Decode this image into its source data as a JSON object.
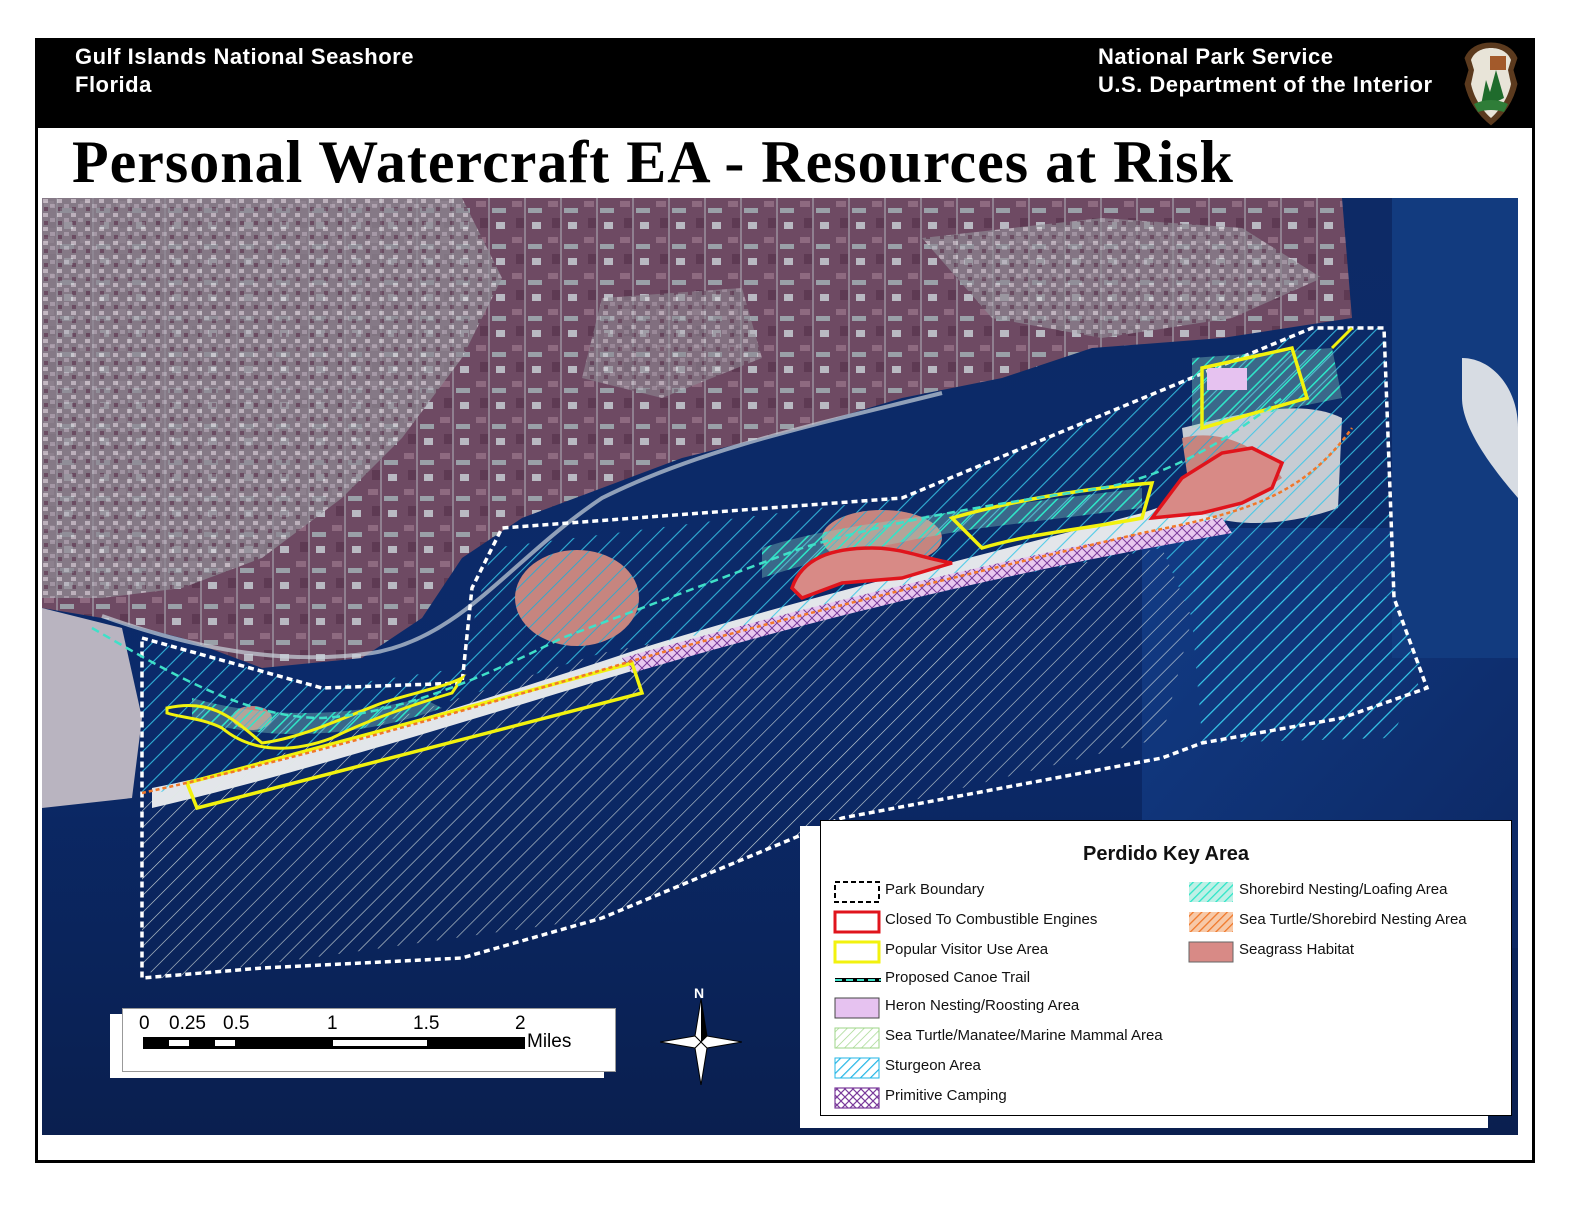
{
  "header": {
    "left_line1": "Gulf Islands National Seashore",
    "left_line2": "Florida",
    "right_line1": "National Park Service",
    "right_line2": "U.S. Department of the Interior",
    "logo_icon": "nps-arrowhead-icon"
  },
  "title": "Personal Watercraft EA - Resources at Risk",
  "legend": {
    "title": "Perdido Key Area",
    "items": [
      {
        "label": "Park Boundary",
        "icon": "dashed-outline",
        "color": "#000000"
      },
      {
        "label": "Closed To Combustible Engines",
        "icon": "outline",
        "color": "#e0141c"
      },
      {
        "label": "Popular Visitor Use Area",
        "icon": "outline",
        "color": "#f2f20e"
      },
      {
        "label": "Proposed Canoe Trail",
        "icon": "dashed-line",
        "color": "#3fe0c8"
      },
      {
        "label": "Heron Nesting/Roosting Area",
        "icon": "fill",
        "color": "#e6c2f0"
      },
      {
        "label": "Sea Turtle/Manatee/Marine Mammal Area",
        "icon": "hatch",
        "color": "#b9e6a0"
      },
      {
        "label": "Sturgeon Area",
        "icon": "hatch",
        "color": "#22b6e6"
      },
      {
        "label": "Primitive Camping",
        "icon": "crosshatch",
        "color": "#7a3a9a"
      },
      {
        "label": "Shorebird Nesting/Loafing Area",
        "icon": "hatch",
        "color": "#2ee6c8"
      },
      {
        "label": "Sea Turtle/Shorebird Nesting Area",
        "icon": "hatch",
        "color": "#f0782a"
      },
      {
        "label": "Seagrass Habitat",
        "icon": "fill",
        "color": "#d88a86"
      }
    ]
  },
  "scalebar": {
    "ticks": [
      "0",
      "0.25",
      "0.5",
      "1",
      "1.5",
      "2"
    ],
    "unit": "Miles"
  },
  "north_arrow": {
    "label": "N",
    "icon": "north-arrow-icon"
  }
}
